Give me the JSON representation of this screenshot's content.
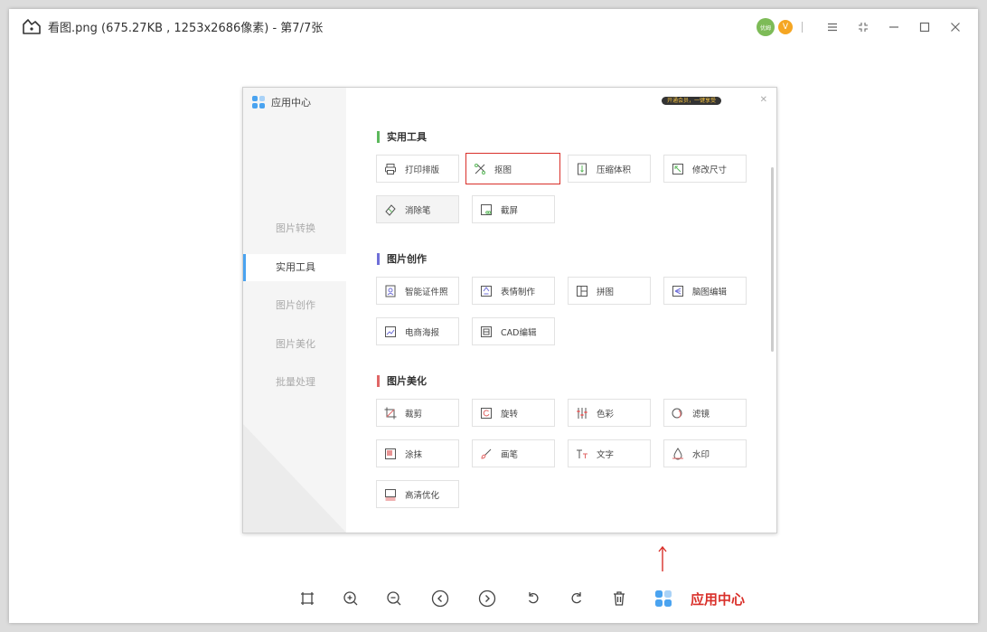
{
  "titlebar": {
    "title": "看图.png (675.27KB , 1253x2686像素) - 第7/7张",
    "avatar_text": "优姆",
    "vip_text": "V"
  },
  "panel": {
    "sidebar_title": "应用中心",
    "sidebar_items": [
      {
        "label": "图片转换",
        "active": false
      },
      {
        "label": "实用工具",
        "active": true
      },
      {
        "label": "图片创作",
        "active": false
      },
      {
        "label": "图片美化",
        "active": false
      },
      {
        "label": "批量处理",
        "active": false
      }
    ],
    "banner": "开通会员，一键享受",
    "sections": [
      {
        "title": "实用工具",
        "color": "#5cb85c",
        "tools": [
          {
            "label": "打印排版",
            "icon": "printer-icon"
          },
          {
            "label": "抠图",
            "icon": "cutout-icon",
            "selected": true
          },
          {
            "label": "压缩体积",
            "icon": "compress-icon"
          },
          {
            "label": "修改尺寸",
            "icon": "resize-icon"
          },
          {
            "label": "消除笔",
            "icon": "eraser-icon",
            "hover": true
          },
          {
            "label": "截屏",
            "icon": "screenshot-icon"
          }
        ]
      },
      {
        "title": "图片创作",
        "color": "#6f6fd8",
        "tools": [
          {
            "label": "智能证件照",
            "icon": "id-photo-icon"
          },
          {
            "label": "表情制作",
            "icon": "emoji-icon"
          },
          {
            "label": "拼图",
            "icon": "collage-icon"
          },
          {
            "label": "脑图编辑",
            "icon": "mindmap-icon"
          },
          {
            "label": "电商海报",
            "icon": "poster-icon"
          },
          {
            "label": "CAD编辑",
            "icon": "cad-icon"
          }
        ]
      },
      {
        "title": "图片美化",
        "color": "#e06666",
        "tools": [
          {
            "label": "裁剪",
            "icon": "crop-icon"
          },
          {
            "label": "旋转",
            "icon": "rotate-icon"
          },
          {
            "label": "色彩",
            "icon": "color-adjust-icon"
          },
          {
            "label": "滤镜",
            "icon": "filter-icon"
          },
          {
            "label": "涂抹",
            "icon": "smudge-icon"
          },
          {
            "label": "画笔",
            "icon": "brush-icon"
          },
          {
            "label": "文字",
            "icon": "text-icon"
          },
          {
            "label": "水印",
            "icon": "watermark-icon"
          },
          {
            "label": "高清优化",
            "icon": "hd-enhance-icon"
          }
        ]
      }
    ]
  },
  "bottom_toolbar": {
    "buttons": [
      "original-size",
      "zoom-in",
      "zoom-out",
      "previous",
      "next",
      "rotate-left",
      "rotate-right",
      "delete",
      "app-center"
    ],
    "annotation": "应用中心",
    "annotation_color": "#d9302a"
  }
}
